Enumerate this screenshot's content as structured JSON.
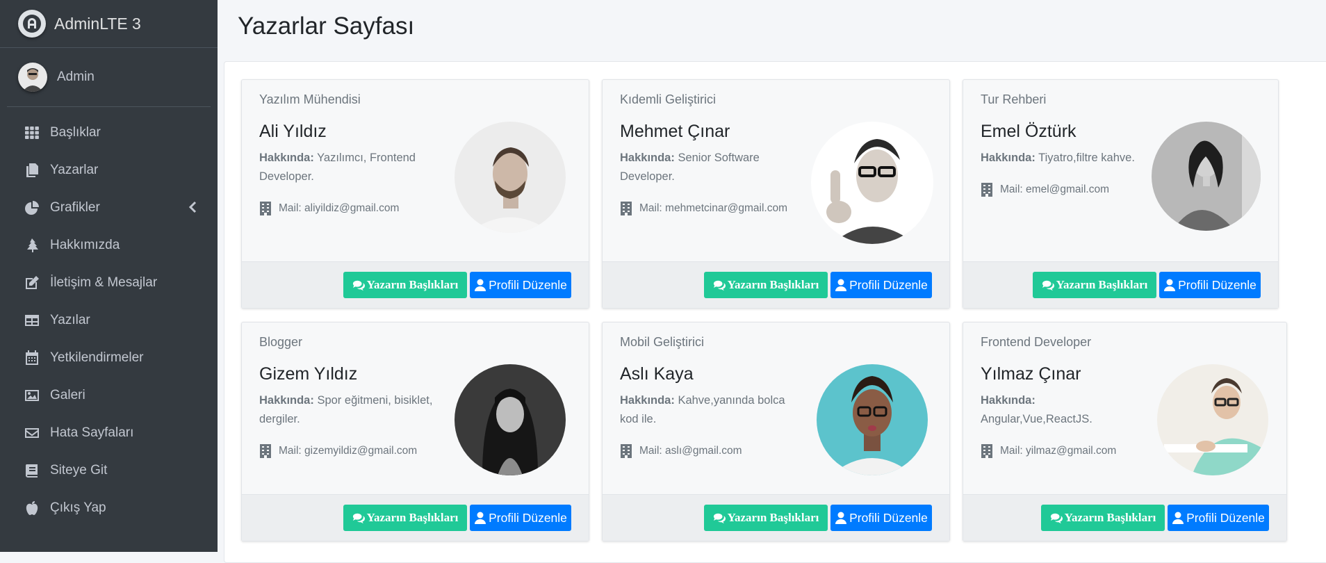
{
  "brand": {
    "name": "AdminLTE 3"
  },
  "user": {
    "name": "Admin"
  },
  "sidebar": {
    "items": [
      {
        "label": "Başlıklar",
        "icon": "th-icon"
      },
      {
        "label": "Yazarlar",
        "icon": "copy-icon"
      },
      {
        "label": "Grafikler",
        "icon": "chart-pie-icon",
        "has_submenu": true
      },
      {
        "label": "Hakkımızda",
        "icon": "tree-icon"
      },
      {
        "label": "İletişim & Mesajlar",
        "icon": "edit-icon"
      },
      {
        "label": "Yazılar",
        "icon": "table-icon"
      },
      {
        "label": "Yetkilendirmeler",
        "icon": "calendar-icon"
      },
      {
        "label": "Galeri",
        "icon": "image-icon"
      },
      {
        "label": "Hata Sayfaları",
        "icon": "envelope-icon"
      },
      {
        "label": "Siteye Git",
        "icon": "book-icon"
      },
      {
        "label": "Çıkış Yap",
        "icon": "apple-icon"
      }
    ]
  },
  "page": {
    "title": "Yazarlar Sayfası"
  },
  "labels": {
    "about": "Hakkında:",
    "mail_prefix": "Mail:",
    "btn_titles": "Yazarın Başlıkları",
    "btn_edit": "Profili Düzenle"
  },
  "authors": [
    {
      "role": "Yazılım Mühendisi",
      "name": "Ali Yıldız",
      "about": "Yazılımcı, Frontend Developer.",
      "mail": "aliyildiz@gmail.com"
    },
    {
      "role": "Kıdemli Geliştirici",
      "name": "Mehmet Çınar",
      "about": "Senior Software Developer.",
      "mail": "mehmetcinar@gmail.com"
    },
    {
      "role": "Tur Rehberi",
      "name": "Emel Öztürk",
      "about": "Tiyatro,filtre kahve.",
      "mail": "emel@gmail.com"
    },
    {
      "role": "Blogger",
      "name": "Gizem Yıldız",
      "about": "Spor eğitmeni, bisiklet, dergiler.",
      "mail": "gizemyildiz@gmail.com"
    },
    {
      "role": "Mobil Geliştirici",
      "name": "Aslı Kaya",
      "about": "Kahve,yanında bolca kod ile.",
      "mail": "aslı@gmail.com"
    },
    {
      "role": "Frontend Developer",
      "name": "Yılmaz Çınar",
      "about": "Angular,Vue,ReactJS.",
      "mail": "yilmaz@gmail.com"
    }
  ],
  "colors": {
    "sidebar": "#343a40",
    "green_button": "#20c997",
    "blue_button": "#007bff"
  }
}
